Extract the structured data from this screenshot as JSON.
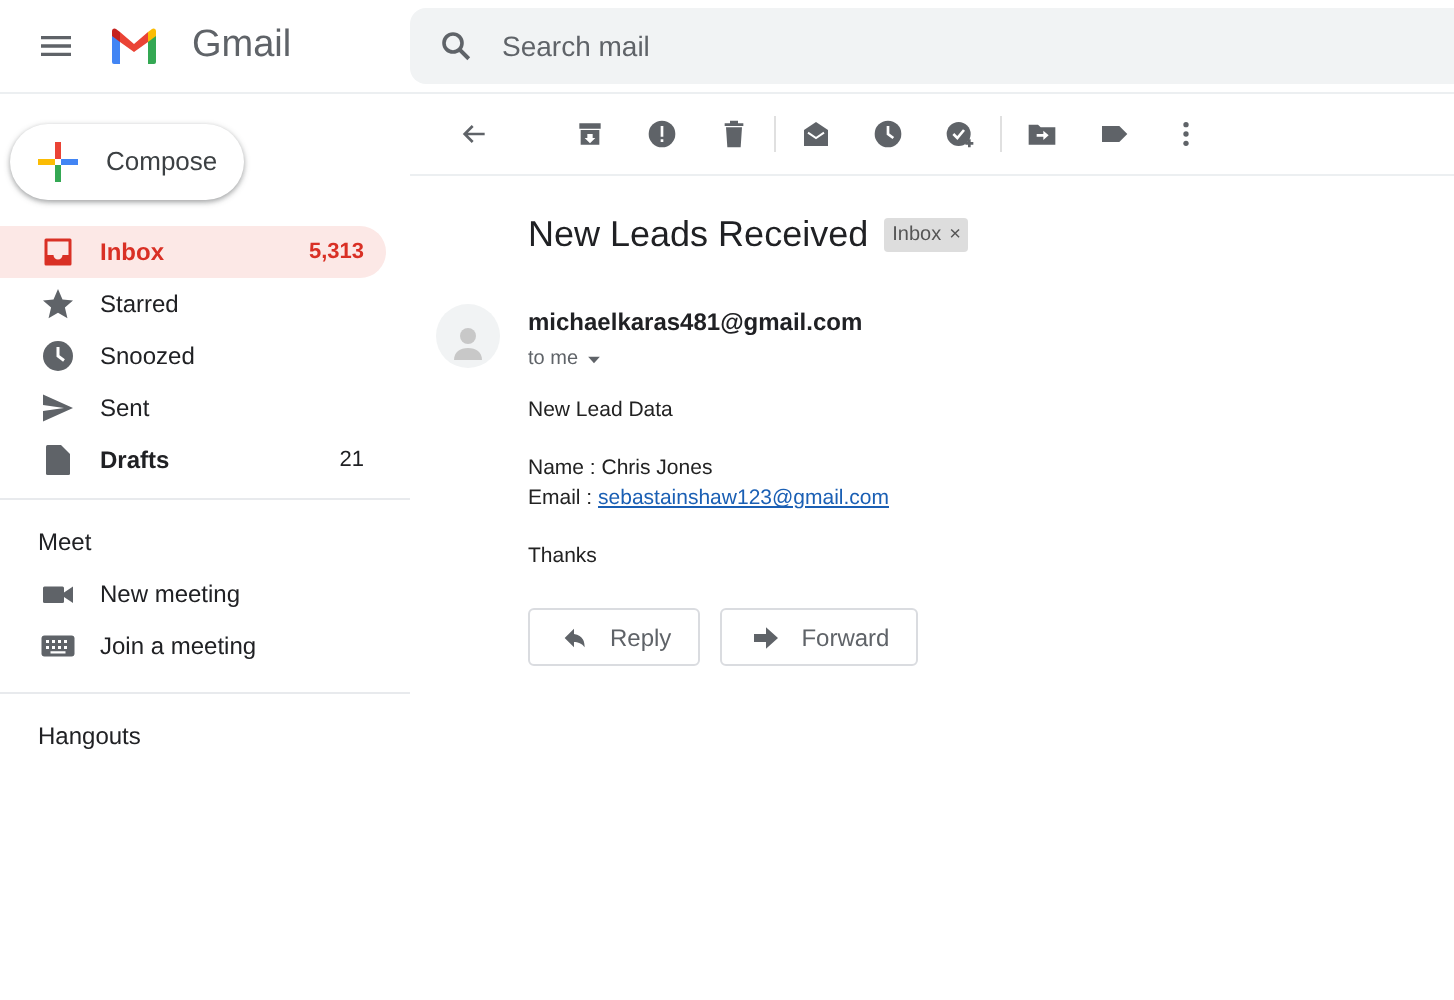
{
  "header": {
    "app_name": "Gmail",
    "search": {
      "placeholder": "Search mail"
    }
  },
  "compose": {
    "label": "Compose"
  },
  "folders": [
    {
      "label": "Inbox",
      "count": "5,313",
      "selected": true,
      "bold": true
    },
    {
      "label": "Starred",
      "selected": false,
      "bold": false
    },
    {
      "label": "Snoozed",
      "selected": false,
      "bold": false
    },
    {
      "label": "Sent",
      "selected": false,
      "bold": false
    },
    {
      "label": "Drafts",
      "count": "21",
      "selected": false,
      "bold": true
    }
  ],
  "meet": {
    "title": "Meet",
    "items": [
      {
        "label": "New meeting"
      },
      {
        "label": "Join a meeting"
      }
    ]
  },
  "hangouts": {
    "title": "Hangouts"
  },
  "message": {
    "subject": "New Leads Received",
    "label": {
      "text": "Inbox",
      "close": "×"
    },
    "sender": "michaelkaras481@gmail.com",
    "recipient": "to me",
    "paragraphs": [
      {
        "lines": [
          {
            "text": "New Lead Data"
          }
        ]
      },
      {
        "lines": [
          {
            "text": "Name : Chris Jones"
          },
          {
            "text": "Email : ",
            "link": "sebastainshaw123@gmail.com"
          }
        ]
      },
      {
        "lines": [
          {
            "text": "Thanks"
          }
        ]
      }
    ],
    "actions": [
      {
        "label": "Reply"
      },
      {
        "label": "Forward"
      }
    ]
  }
}
